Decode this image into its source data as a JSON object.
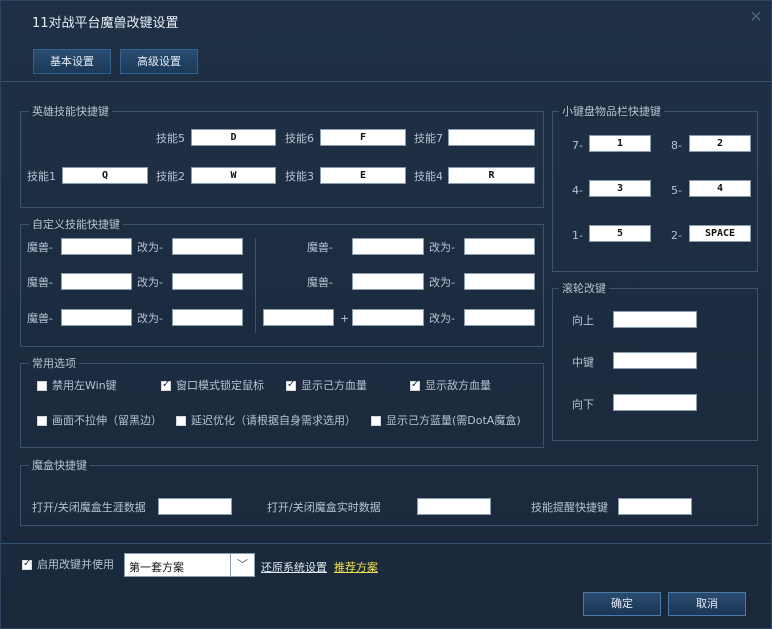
{
  "window": {
    "title": "11对战平台魔兽改键设置",
    "close_glyph": "✕"
  },
  "tabs": [
    "基本设置",
    "高级设置"
  ],
  "hero_skills": {
    "title": "英雄技能快捷键",
    "row1": [
      {
        "label": "技能5",
        "value": "D"
      },
      {
        "label": "技能6",
        "value": "F"
      },
      {
        "label": "技能7",
        "value": ""
      }
    ],
    "row2": [
      {
        "label": "技能1",
        "value": "Q"
      },
      {
        "label": "技能2",
        "value": "W"
      },
      {
        "label": "技能3",
        "value": "E"
      },
      {
        "label": "技能4",
        "value": "R"
      }
    ]
  },
  "custom_skills": {
    "title": "自定义技能快捷键",
    "warcraft_label": "魔兽-",
    "change_label": "改为-",
    "plus": "+"
  },
  "options": {
    "title": "常用选项",
    "items": [
      {
        "label": "禁用左Win键",
        "checked": false
      },
      {
        "label": "窗口模式锁定鼠标",
        "checked": true
      },
      {
        "label": "显示己方血量",
        "checked": true
      },
      {
        "label": "显示敌方血量",
        "checked": true
      },
      {
        "label": "画面不拉伸（留黑边）",
        "checked": false
      },
      {
        "label": "延迟优化（请根据自身需求选用）",
        "checked": false
      },
      {
        "label": "显示己方蓝量(需DotA魔盒)",
        "checked": false
      }
    ]
  },
  "magic_box": {
    "title": "魔盒快捷键",
    "labels": [
      "打开/关闭魔盒生涯数据",
      "打开/关闭魔盒实时数据",
      "技能提醒快捷键"
    ]
  },
  "numpad": {
    "title": "小键盘物品栏快捷键",
    "items": [
      {
        "label": "7-",
        "value": "1"
      },
      {
        "label": "8-",
        "value": "2"
      },
      {
        "label": "4-",
        "value": "3"
      },
      {
        "label": "5-",
        "value": "4"
      },
      {
        "label": "1-",
        "value": "5"
      },
      {
        "label": "2-",
        "value": "SPACE"
      }
    ]
  },
  "wheel": {
    "title": "滚轮改键",
    "labels": [
      "向上",
      "中键",
      "向下"
    ]
  },
  "bottom": {
    "enable_label": "启用改键并使用",
    "enable_checked": true,
    "scheme_value": "第一套方案",
    "restore_link": "还原系统设置",
    "recommend_link": "推荐方案",
    "ok": "确定",
    "cancel": "取消",
    "colors": {
      "restore": "#dfe7ef",
      "recommend": "#f0e34a"
    }
  }
}
